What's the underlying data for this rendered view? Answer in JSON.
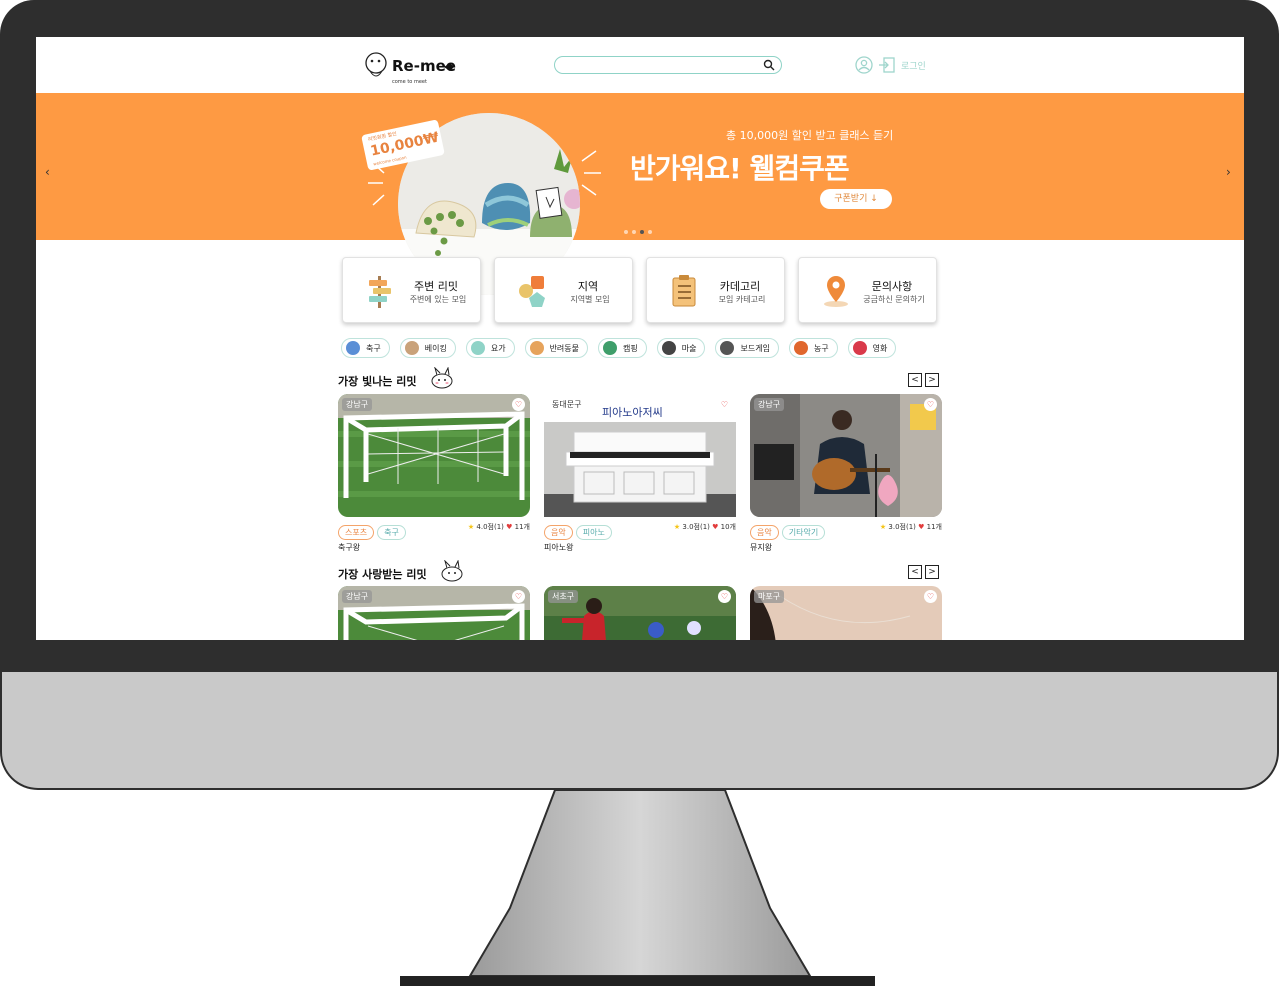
{
  "header": {
    "logo_text": "Re-meet",
    "search": {
      "value": "",
      "placeholder": ""
    },
    "login_label": "로그인"
  },
  "banner": {
    "subtitle": "총 10,000원 할인 받고 클래스 듣기",
    "title": "반가워요! 웰컴쿠폰",
    "button_label": "구폰받기 ↓",
    "coupon_tag": "10,000₩"
  },
  "quick_menu": [
    {
      "title": "주변 리밋",
      "subtitle": "주변에 있는 모임"
    },
    {
      "title": "지역",
      "subtitle": "지역별 모임"
    },
    {
      "title": "카데고리",
      "subtitle": "모임 카테고리"
    },
    {
      "title": "문의사항",
      "subtitle": "궁금하신 문의하기"
    }
  ],
  "chips": [
    {
      "label": "축구",
      "color": "#5b8fd6"
    },
    {
      "label": "베이킹",
      "color": "#c9a27a"
    },
    {
      "label": "요가",
      "color": "#8fd3c7"
    },
    {
      "label": "반려동물",
      "color": "#e6a35c"
    },
    {
      "label": "캠핑",
      "color": "#3e9e6a"
    },
    {
      "label": "마술",
      "color": "#444444"
    },
    {
      "label": "보드게임",
      "color": "#555555"
    },
    {
      "label": "농구",
      "color": "#e0672d"
    },
    {
      "label": "영화",
      "color": "#d93a4a"
    }
  ],
  "section1": {
    "title": "가장 빛나는 리밋",
    "cards": [
      {
        "region": "강남구",
        "tag1": "스포츠",
        "tag2": "축구",
        "rating": "4.0점(1)",
        "likes": "11개",
        "name": "축구왕"
      },
      {
        "region": "동대문구",
        "tag1": "음악",
        "tag2": "피아노",
        "rating": "3.0점(1)",
        "likes": "10개",
        "name": "피아노왕"
      },
      {
        "region": "강남구",
        "tag1": "음악",
        "tag2": "기타악기",
        "rating": "3.0점(1)",
        "likes": "11개",
        "name": "뮤지왕"
      }
    ]
  },
  "section2": {
    "title": "가장 사랑받는 리밋",
    "cards": [
      {
        "region": "강남구"
      },
      {
        "region": "서초구"
      },
      {
        "region": "마포구"
      }
    ]
  },
  "piano_sign": "피아노아저씨"
}
